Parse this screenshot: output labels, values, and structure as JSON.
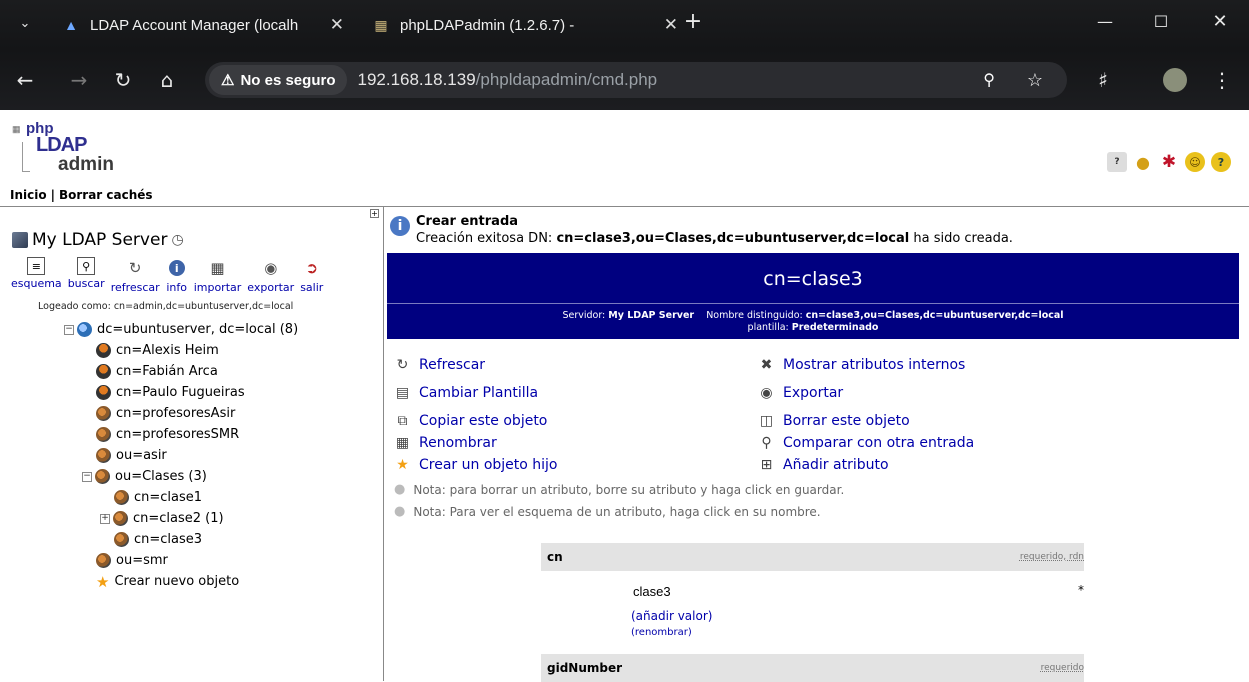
{
  "browser": {
    "tabs": [
      {
        "title": "LDAP Account Manager (localh"
      },
      {
        "title": "phpLDAPadmin (1.2.6.7) -"
      }
    ],
    "security_label": "No es seguro",
    "url_host": "192.168.18.139",
    "url_path": "/phpldapadmin/cmd.php"
  },
  "logo": {
    "php": "php",
    "ldap": "LDAP",
    "admin": "admin"
  },
  "topnav": {
    "home": "Inicio",
    "separator": "|",
    "clear_cache": "Borrar cachés"
  },
  "sidebar": {
    "server_name": "My LDAP Server",
    "tools": [
      {
        "label": "esquema",
        "icon": "schema-icon"
      },
      {
        "label": "buscar",
        "icon": "search-icon"
      },
      {
        "label": "refrescar",
        "icon": "refresh-icon"
      },
      {
        "label": "info",
        "icon": "info-icon"
      },
      {
        "label": "importar",
        "icon": "import-icon"
      },
      {
        "label": "exportar",
        "icon": "export-icon"
      },
      {
        "label": "salir",
        "icon": "logout-icon"
      }
    ],
    "logged_as": "Logeado como: cn=admin,dc=ubuntuserver,dc=local",
    "tree": {
      "root": "dc=ubuntuserver, dc=local (8)",
      "items": [
        "cn=Alexis Heim",
        "cn=Fabián Arca",
        "cn=Paulo Fugueiras",
        "cn=profesoresAsir",
        "cn=profesoresSMR",
        "ou=asir",
        "ou=Clases (3)",
        "cn=clase1",
        "cn=clase2 (1)",
        "cn=clase3",
        "ou=smr",
        "Crear nuevo objeto"
      ]
    }
  },
  "main": {
    "info_title": "Crear entrada",
    "info_prefix": "Creación exitosa DN: ",
    "info_dn": "cn=clase3,ou=Clases,dc=ubuntuserver,dc=local",
    "info_suffix": " ha sido creada.",
    "banner_dn": "cn=clase3",
    "banner_server_label": "Servidor:",
    "banner_server": "My LDAP Server",
    "banner_dn_label": "Nombre distinguido:",
    "banner_dn_full": "cn=clase3,ou=Clases,dc=ubuntuserver,dc=local",
    "banner_template_label": "plantilla:",
    "banner_template": "Predeterminado",
    "actions_left": [
      "Refrescar",
      "Cambiar Plantilla",
      "Copiar este objeto",
      "Renombrar",
      "Crear un objeto hijo"
    ],
    "actions_right": [
      "Mostrar atributos internos",
      "Exportar",
      "Borrar este objeto",
      "Comparar con otra entrada",
      "Añadir atributo"
    ],
    "notes": [
      "Nota: para borrar un atributo, borre su atributo y haga click en guardar.",
      "Nota: Para ver el esquema de un atributo, haga click en su nombre."
    ],
    "attr_cn": {
      "name": "cn",
      "req": "requerido, rdn",
      "value": "clase3",
      "star": "*",
      "add_value": "(añadir valor)",
      "rename": "(renombrar)"
    },
    "attr_gid": {
      "name": "gidNumber",
      "req": "requerido"
    }
  }
}
